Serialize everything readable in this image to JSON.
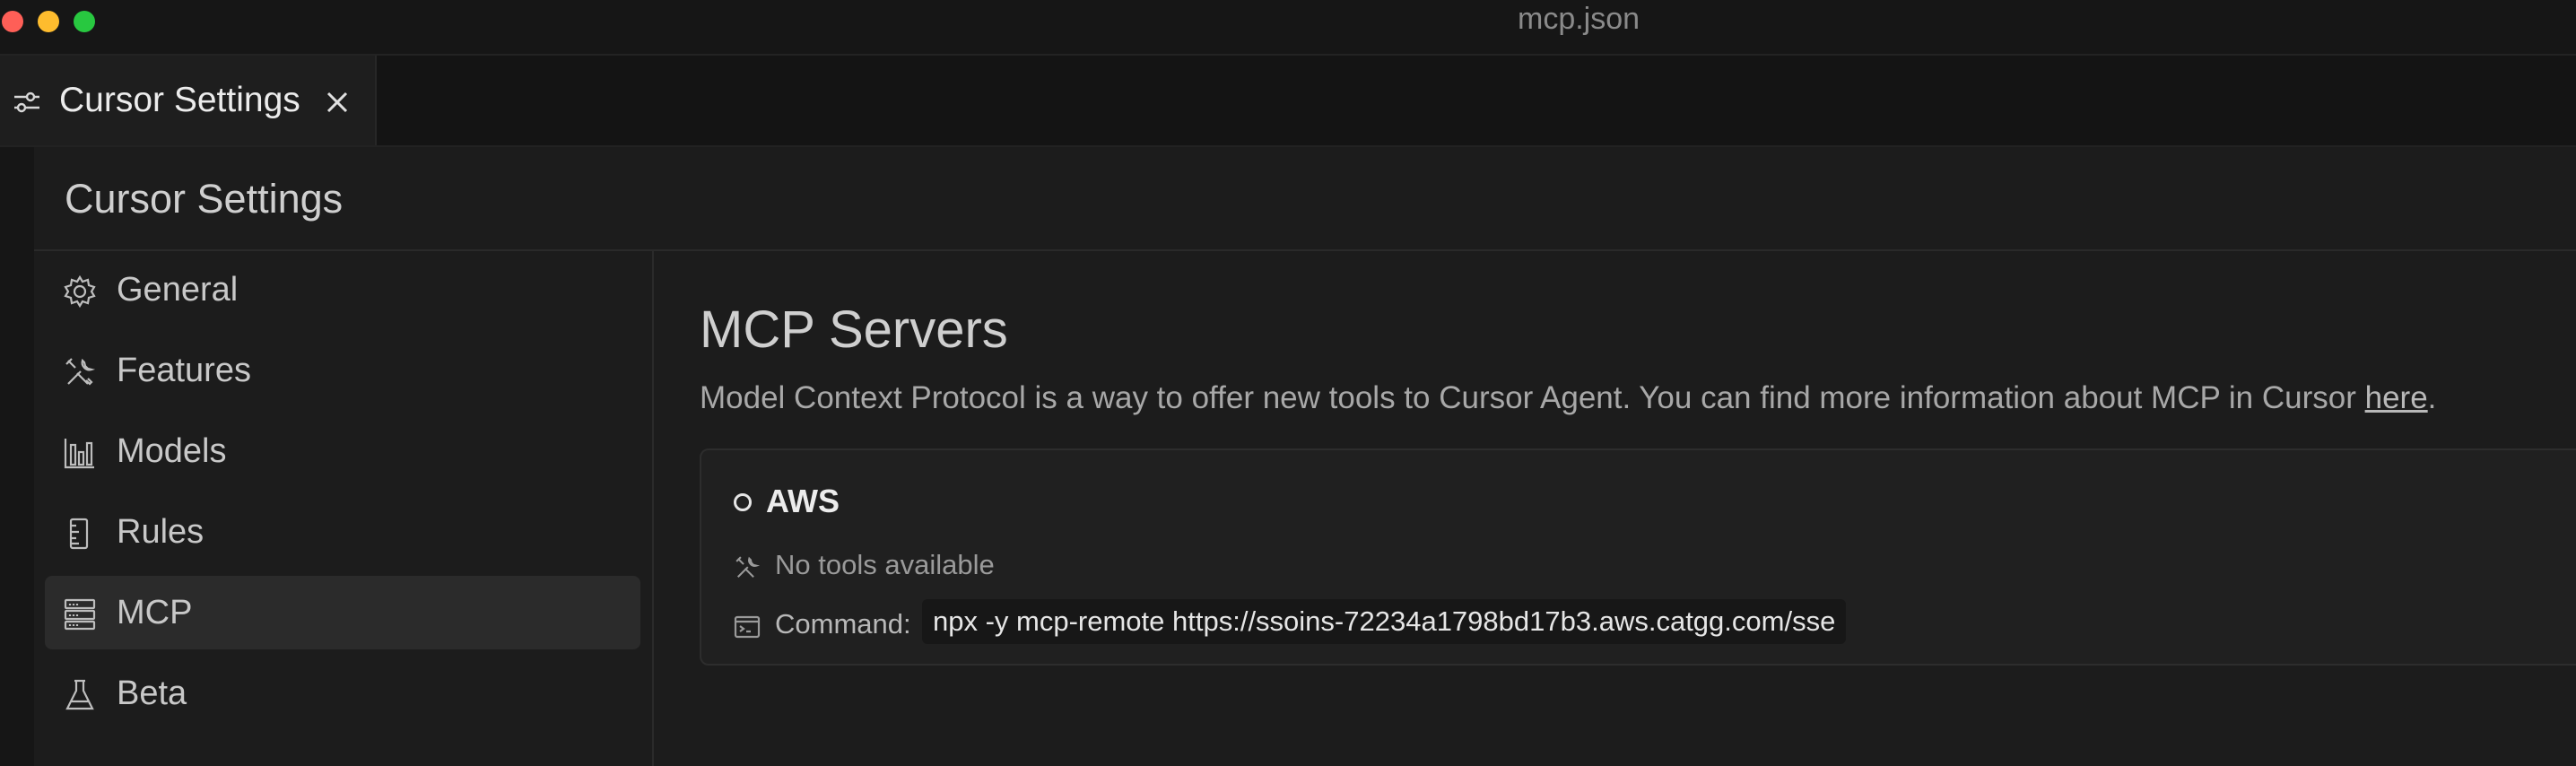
{
  "window": {
    "title": "mcp.json"
  },
  "tab": {
    "label": "Cursor Settings",
    "icon": "sliders-icon"
  },
  "settings": {
    "title": "Cursor Settings"
  },
  "sidebar": {
    "items": [
      {
        "label": "General",
        "icon": "gear-icon"
      },
      {
        "label": "Features",
        "icon": "tools-icon"
      },
      {
        "label": "Models",
        "icon": "bar-chart-icon"
      },
      {
        "label": "Rules",
        "icon": "ruler-icon"
      },
      {
        "label": "MCP",
        "icon": "server-icon",
        "active": true
      },
      {
        "label": "Beta",
        "icon": "flask-icon"
      }
    ]
  },
  "main": {
    "title": "MCP Servers",
    "description": "Model Context Protocol is a way to offer new tools to Cursor Agent. You can find more information about MCP in Cursor ",
    "link_text": "here",
    "after_link": ".",
    "server": {
      "name": "AWS",
      "tools_status": "No tools available",
      "command_label": "Command:",
      "command_value": "npx -y mcp-remote https://ssoins-72234a1798bd17b3.aws.catgg.com/sse"
    }
  },
  "colors": {
    "background": "#1c1c1c",
    "accent_text": "#ececec",
    "traffic_red": "#fe5f57",
    "traffic_yellow": "#febc2e",
    "traffic_green": "#28c840"
  }
}
